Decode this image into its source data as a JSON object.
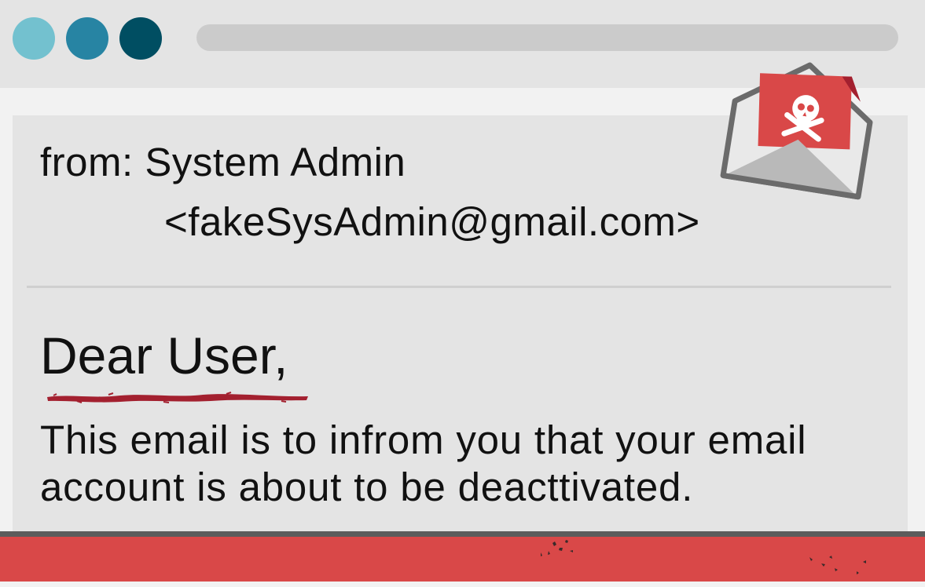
{
  "window": {
    "controls": [
      {
        "name": "window-control-close",
        "color": "#73c1cf"
      },
      {
        "name": "window-control-minimize",
        "color": "#2784a3"
      },
      {
        "name": "window-control-maximize",
        "color": "#004e62"
      }
    ],
    "address_bar_value": ""
  },
  "email": {
    "from_line": "from: System Admin",
    "from_address": "<fakeSysAdmin@gmail.com>",
    "greeting": "Dear User,",
    "body": "This email is to infrom you that your email account is about to be deacttivated."
  },
  "icons": {
    "envelope": "malicious-envelope-icon",
    "skull": "skull-crossbones-icon"
  },
  "colors": {
    "accent_red": "#d94848",
    "underline_red": "#a3202f",
    "titlebar": "#e4e4e4",
    "email_pane": "#e4e4e4"
  }
}
